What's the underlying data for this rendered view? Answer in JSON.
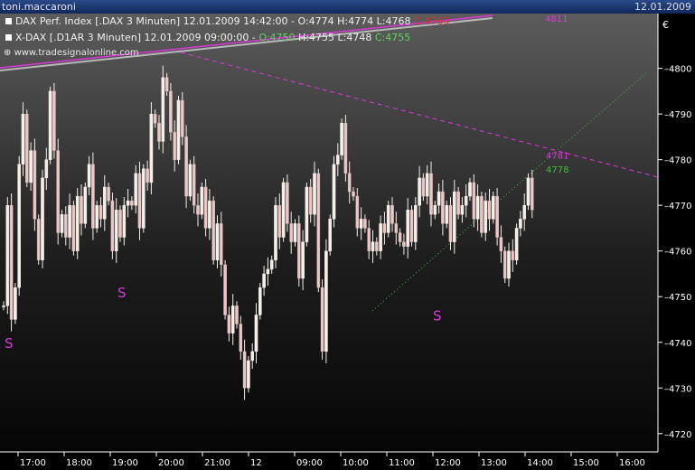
{
  "window": {
    "title": "toni.maccaroni",
    "date": "12.01.2009"
  },
  "legend": {
    "dax_label": "DAX Perf. Index [.DAX  3 Minuten] 12.01.2009 14:42:00 - ",
    "dax_o": "O:4774",
    "dax_h": " H:4774",
    "dax_l": " L:4768",
    "dax_c": " C:4769",
    "xdax_label": "X-DAX [.D1AR  3 Minuten] 12.01.2009 09:00:00 - ",
    "xdax_o": "O:4750",
    "xdax_h": " H:4755",
    "xdax_l": " L:4748",
    "xdax_c": " C:4755"
  },
  "watermark": "www.tradesignalonline.com",
  "colors": {
    "magenta": "#d83ad8",
    "resistance_label": "#d83ad8",
    "support_label": "#3fbf3f",
    "candle": "#f4efe8",
    "axis": "#ffffff"
  },
  "chart_data": {
    "type": "candlestick",
    "currency_symbol": "€",
    "ylim": [
      4716,
      4812
    ],
    "y_ticks": [
      4720,
      4730,
      4740,
      4750,
      4760,
      4770,
      4780,
      4790,
      4800
    ],
    "x_ticks": [
      "17:00",
      "18:00",
      "19:00",
      "20:00",
      "21:00",
      "12",
      "09:00",
      "10:00",
      "11:00",
      "12:00",
      "13:00",
      "14:00",
      "15:00",
      "16:00"
    ],
    "line_labels": [
      {
        "text": "4781",
        "value": 4781,
        "line": "resistance"
      },
      {
        "text": "4778",
        "value": 4778,
        "line": "support"
      },
      {
        "text": "4811",
        "value": 4811,
        "line": "upper"
      }
    ],
    "annotations": [
      {
        "text": "S",
        "value": 4740
      },
      {
        "text": "S",
        "value": 4751
      },
      {
        "text": "S",
        "value": 4746
      }
    ],
    "closes": [
      4748,
      4770,
      4745,
      4752,
      4779,
      4790,
      4775,
      4782,
      4767,
      4758,
      4776,
      4780,
      4795,
      4782,
      4764,
      4768,
      4763,
      4770,
      4760,
      4772,
      4766,
      4774,
      4779,
      4765,
      4770,
      4767,
      4774,
      4771,
      4760,
      4769,
      4763,
      4770,
      4771,
      4770,
      4777,
      4765,
      4778,
      4775,
      4790,
      4788,
      4784,
      4798,
      4795,
      4786,
      4780,
      4793,
      4785,
      4772,
      4779,
      4770,
      4768,
      4774,
      4765,
      4771,
      4758,
      4766,
      4757,
      4746,
      4742,
      4748,
      4744,
      4738,
      4730,
      4736,
      4738,
      4746,
      4752,
      4755,
      4756,
      4758,
      4770,
      4763,
      4775,
      4766,
      4762,
      4766,
      4754,
      4762,
      4774,
      4768,
      4777,
      4752,
      4738,
      4760,
      4767,
      4779,
      4781,
      4788,
      4777,
      4773,
      4772,
      4765,
      4767,
      4765,
      4760,
      4762,
      4760,
      4766,
      4764,
      4770,
      4766,
      4764,
      4762,
      4761,
      4769,
      4762,
      4770,
      4776,
      4772,
      4777,
      4768,
      4770,
      4773,
      4766,
      4770,
      4762,
      4773,
      4768,
      4770,
      4772,
      4775,
      4767,
      4772,
      4764,
      4771,
      4767,
      4772,
      4763,
      4760,
      4754,
      4760,
      4758,
      4765,
      4767,
      4770,
      4776,
      4769
    ]
  }
}
